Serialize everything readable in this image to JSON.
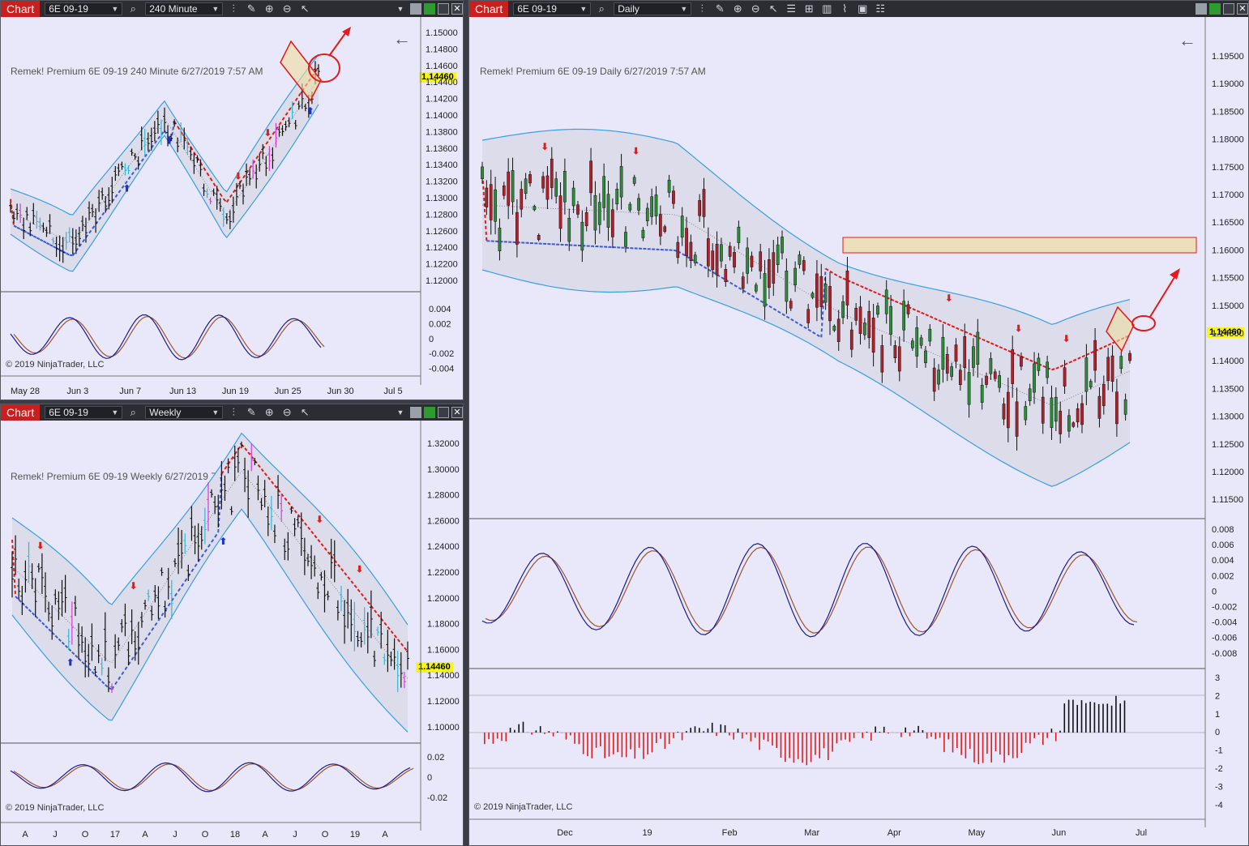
{
  "instrument": "6E 09-19",
  "chart_tab_label": "Chart",
  "last_price": "1.14460",
  "copyright": "© 2019 NinjaTrader, LLC",
  "icons": [
    "search-icon",
    "bar-type-icon",
    "pencil-icon",
    "zoom-in-icon",
    "zoom-out-icon",
    "pointer-icon",
    "properties-icon",
    "window-layout-icon"
  ],
  "panels": {
    "p240": {
      "interval": "240 Minute",
      "legend": "Remek!  Premium  6E 09-19  240 Minute  6/27/2019 7:57 AM",
      "y_ticks": [
        "1.15000",
        "1.14800",
        "1.14600",
        "1.14400",
        "1.14200",
        "1.14000",
        "1.13800",
        "1.13600",
        "1.13400",
        "1.13200",
        "1.13000",
        "1.12800",
        "1.12600",
        "1.12400",
        "1.12200",
        "1.12000"
      ],
      "osc_ticks": [
        "0.004",
        "0.002",
        "0",
        "-0.002",
        "-0.004"
      ],
      "x_ticks": [
        "May 28",
        "Jun 3",
        "Jun 7",
        "Jun 13",
        "Jun 19",
        "Jun 25",
        "Jun 30",
        "Jul 5"
      ]
    },
    "weekly": {
      "interval": "Weekly",
      "legend": "Remek!  Premium  6E 09-19  Weekly  6/27/2019 7:57 AM",
      "y_ticks": [
        "1.32000",
        "1.30000",
        "1.28000",
        "1.26000",
        "1.24000",
        "1.22000",
        "1.20000",
        "1.18000",
        "1.16000",
        "1.14000",
        "1.12000",
        "1.10000"
      ],
      "osc_ticks": [
        "0.02",
        "0",
        "-0.02"
      ],
      "x_ticks": [
        "A",
        "J",
        "O",
        "17",
        "A",
        "J",
        "O",
        "18",
        "A",
        "J",
        "O",
        "19",
        "A"
      ]
    },
    "daily": {
      "interval": "Daily",
      "legend": "Remek!  Premium  6E 09-19  Daily  6/27/2019 7:57 AM",
      "y_ticks": [
        "1.19500",
        "1.19000",
        "1.18500",
        "1.18000",
        "1.17500",
        "1.17000",
        "1.16500",
        "1.16000",
        "1.15500",
        "1.15000",
        "1.14500",
        "1.14000",
        "1.13500",
        "1.13000",
        "1.12500",
        "1.12000",
        "1.11500"
      ],
      "osc_ticks": [
        "0.008",
        "0.006",
        "0.004",
        "0.002",
        "0",
        "-0.002",
        "-0.004",
        "-0.006",
        "-0.008"
      ],
      "hist_ticks": [
        "3",
        "2",
        "1",
        "0",
        "-1",
        "-2",
        "-3",
        "-4"
      ],
      "x_ticks": [
        "Dec",
        "19",
        "Feb",
        "Mar",
        "Apr",
        "May",
        "Jun",
        "Jul"
      ]
    }
  }
}
